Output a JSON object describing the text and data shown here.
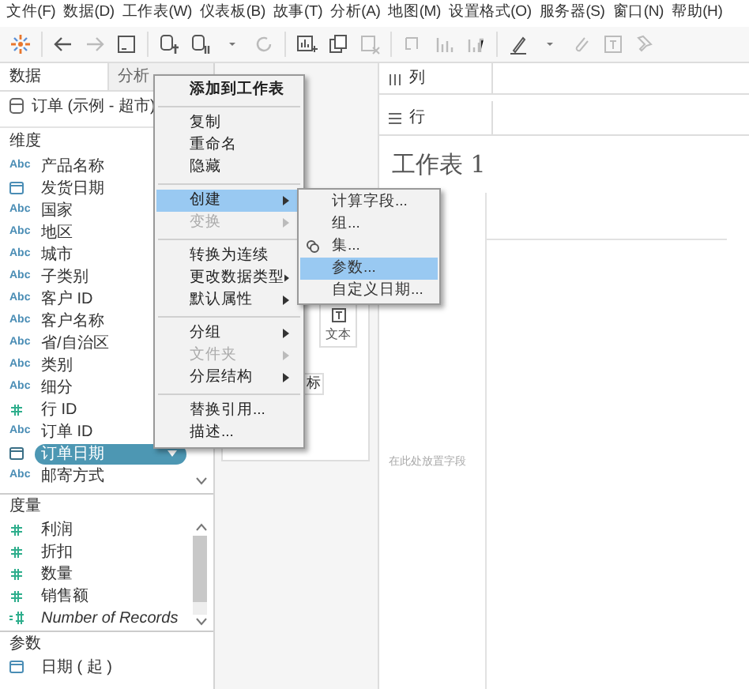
{
  "menu_bar": [
    "文件(F)",
    "数据(D)",
    "工作表(W)",
    "仪表板(B)",
    "故事(T)",
    "分析(A)",
    "地图(M)",
    "设置格式(O)",
    "服务器(S)",
    "窗口(N)",
    "帮助(H)"
  ],
  "side_tabs": [
    {
      "label": "数据",
      "selected": true
    },
    {
      "label": "分析",
      "selected": false
    }
  ],
  "data_source": "订单 (示例 - 超市)",
  "dimensions": {
    "title": "维度",
    "items": [
      {
        "kind": "string",
        "type_label": "Abc",
        "label": "产品名称",
        "selected": false
      },
      {
        "kind": "date",
        "label": "发货日期",
        "selected": false
      },
      {
        "kind": "string",
        "type_label": "Abc",
        "label": "国家",
        "selected": false
      },
      {
        "kind": "string",
        "type_label": "Abc",
        "label": "地区",
        "selected": false
      },
      {
        "kind": "string",
        "type_label": "Abc",
        "label": "城市",
        "selected": false
      },
      {
        "kind": "string",
        "type_label": "Abc",
        "label": "子类别",
        "selected": false
      },
      {
        "kind": "string",
        "type_label": "Abc",
        "label": "客户 ID",
        "selected": false
      },
      {
        "kind": "string",
        "type_label": "Abc",
        "label": "客户名称",
        "selected": false
      },
      {
        "kind": "string",
        "type_label": "Abc",
        "label": "省/自治区",
        "selected": false
      },
      {
        "kind": "string",
        "type_label": "Abc",
        "label": "类别",
        "selected": false
      },
      {
        "kind": "string",
        "type_label": "Abc",
        "label": "细分",
        "selected": false
      },
      {
        "kind": "number",
        "label": "行 ID",
        "selected": false
      },
      {
        "kind": "string",
        "type_label": "Abc",
        "label": "订单 ID",
        "selected": false
      },
      {
        "kind": "date",
        "label": "订单日期",
        "selected": true
      },
      {
        "kind": "string",
        "type_label": "Abc",
        "label": "邮寄方式",
        "selected": false
      }
    ]
  },
  "measures": {
    "title": "度量",
    "items": [
      {
        "kind": "number",
        "label": "利润",
        "selected": false
      },
      {
        "kind": "number",
        "label": "折扣",
        "selected": false
      },
      {
        "kind": "number",
        "label": "数量",
        "selected": false
      },
      {
        "kind": "number",
        "label": "销售额",
        "selected": false
      },
      {
        "kind": "calculated",
        "label": "Number of Records",
        "selected": false
      }
    ]
  },
  "parameters": {
    "title": "参数",
    "items": [
      {
        "kind": "date",
        "label": "日期 ( 起 )",
        "selected": false
      }
    ]
  },
  "marks": {
    "text_button": "文本",
    "label_fragment": "标"
  },
  "columns_shelf": "列",
  "rows_shelf": "行",
  "sheet": {
    "title": "工作表 1",
    "drop_hint": "在此处放置字段"
  },
  "context_menu": [
    {
      "kind": "item",
      "label": "添加到工作表",
      "default": true,
      "disabled": false,
      "submenu": false,
      "selected": false
    },
    {
      "kind": "divider"
    },
    {
      "kind": "item",
      "label": "复制",
      "default": false,
      "disabled": false,
      "submenu": false,
      "selected": false
    },
    {
      "kind": "item",
      "label": "重命名",
      "default": false,
      "disabled": false,
      "submenu": false,
      "selected": false
    },
    {
      "kind": "item",
      "label": "隐藏",
      "default": false,
      "disabled": false,
      "submenu": false,
      "selected": false
    },
    {
      "kind": "divider"
    },
    {
      "kind": "item",
      "label": "创建",
      "default": false,
      "disabled": false,
      "submenu": true,
      "selected": true
    },
    {
      "kind": "item",
      "label": "变换",
      "default": false,
      "disabled": true,
      "submenu": true,
      "selected": false
    },
    {
      "kind": "divider"
    },
    {
      "kind": "item",
      "label": "转换为连续",
      "default": false,
      "disabled": false,
      "submenu": false,
      "selected": false
    },
    {
      "kind": "item",
      "label": "更改数据类型",
      "default": false,
      "disabled": false,
      "submenu": true,
      "selected": false
    },
    {
      "kind": "item",
      "label": "默认属性",
      "default": false,
      "disabled": false,
      "submenu": true,
      "selected": false
    },
    {
      "kind": "divider"
    },
    {
      "kind": "item",
      "label": "分组",
      "default": false,
      "disabled": false,
      "submenu": true,
      "selected": false
    },
    {
      "kind": "item",
      "label": "文件夹",
      "default": false,
      "disabled": true,
      "submenu": true,
      "selected": false
    },
    {
      "kind": "item",
      "label": "分层结构",
      "default": false,
      "disabled": false,
      "submenu": true,
      "selected": false
    },
    {
      "kind": "divider"
    },
    {
      "kind": "item",
      "label": "替换引用...",
      "default": false,
      "disabled": false,
      "submenu": false,
      "selected": false
    },
    {
      "kind": "item",
      "label": "描述...",
      "default": false,
      "disabled": false,
      "submenu": false,
      "selected": false
    }
  ],
  "create_submenu": [
    {
      "kind": "item",
      "label": "计算字段...",
      "selected": false
    },
    {
      "kind": "item",
      "label": "组...",
      "selected": false
    },
    {
      "kind": "set",
      "label": "集...",
      "selected": false
    },
    {
      "kind": "item",
      "label": "参数...",
      "selected": true
    },
    {
      "kind": "item",
      "label": "自定义日期...",
      "selected": false
    }
  ]
}
